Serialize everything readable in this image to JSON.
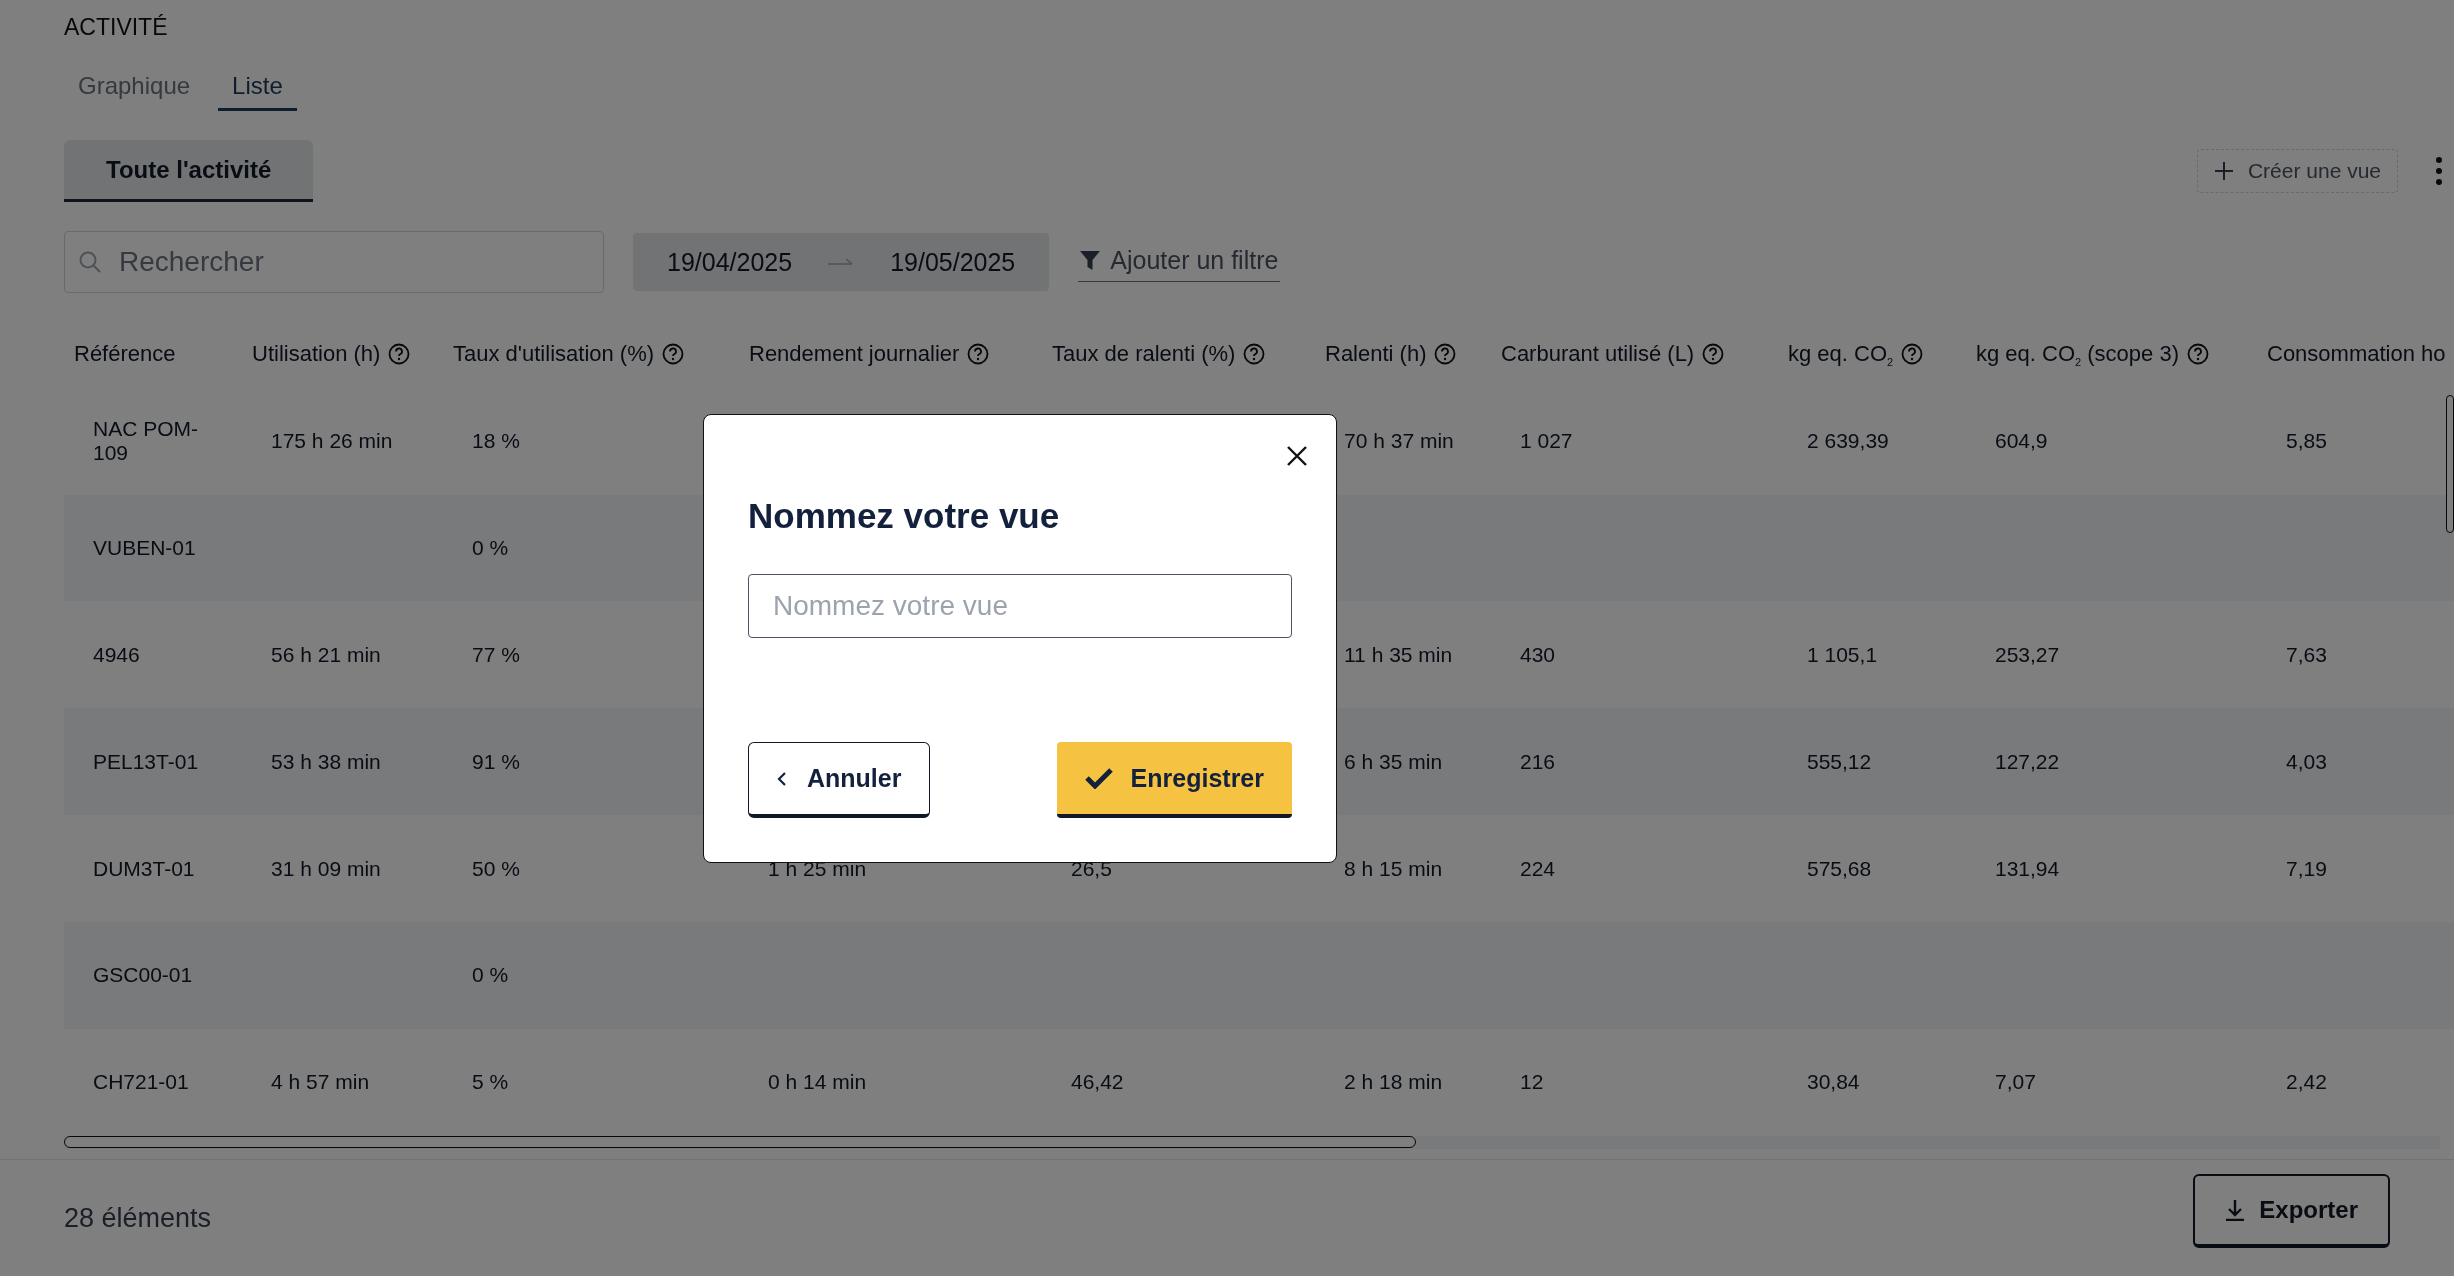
{
  "section_title": "ACTIVITÉ",
  "tabs": [
    {
      "label": "Graphique",
      "selected": false
    },
    {
      "label": "Liste",
      "selected": true
    }
  ],
  "views": [
    {
      "label": "Toute l'activité",
      "selected": true
    }
  ],
  "create_view": {
    "label": "Créer une vue"
  },
  "search": {
    "placeholder": "Rechercher"
  },
  "date_range": {
    "start": "19/04/2025",
    "end": "19/05/2025"
  },
  "filter": {
    "label": "Ajouter un filtre"
  },
  "table": {
    "columns": [
      {
        "label": "Référence",
        "help_icon": false
      },
      {
        "label": "Utilisation (h)",
        "help_icon": true
      },
      {
        "label": "Taux d'utilisation (%)",
        "help_icon": true
      },
      {
        "label": "Rendement journalier",
        "help_icon": true
      },
      {
        "label": "Taux de ralenti (%)",
        "help_icon": true
      },
      {
        "label": "Ralenti (h)",
        "help_icon": true
      },
      {
        "label": "Carburant utilisé (L)",
        "help_icon": true
      },
      {
        "label": "kg eq. CO$_{2}$",
        "help_icon": true
      },
      {
        "label": "kg eq. CO$_{2}$ (scope 3)",
        "help_icon": true
      },
      {
        "label": "Consommation ho",
        "help_icon": false
      }
    ],
    "rows": [
      [
        "NAC POM-109",
        "175 h 26 min",
        "18 %",
        null,
        null,
        "70 h 37 min",
        "1 027",
        "2 639,39",
        "604,9",
        "5,85"
      ],
      [
        "VUBEN-01",
        null,
        "0 %",
        null,
        null,
        null,
        null,
        null,
        null,
        null
      ],
      [
        "4946",
        "56 h 21 min",
        "77 %",
        null,
        null,
        "11 h 35 min",
        "430",
        "1 105,1",
        "253,27",
        "7,63"
      ],
      [
        "PEL13T-01",
        "53 h 38 min",
        "91 %",
        null,
        null,
        "6 h 35 min",
        "216",
        "555,12",
        "127,22",
        "4,03"
      ],
      [
        "DUM3T-01",
        "31 h 09 min",
        "50 %",
        "1 h 25 min",
        "26,5",
        "8 h 15 min",
        "224",
        "575,68",
        "131,94",
        "7,19"
      ],
      [
        "GSC00-01",
        null,
        "0 %",
        null,
        null,
        null,
        null,
        null,
        null,
        null
      ],
      [
        "CH721-01",
        "4 h 57 min",
        "5 %",
        "0 h 14 min",
        "46,42",
        "2 h 18 min",
        "12",
        "30,84",
        "7,07",
        "2,42"
      ]
    ]
  },
  "footer": {
    "count": "28 éléments",
    "export": "Exporter"
  },
  "dialog": {
    "title": "Nommez votre vue",
    "placeholder": "Nommez votre vue",
    "cancel": "Annuler",
    "save": "Enregistrer"
  }
}
